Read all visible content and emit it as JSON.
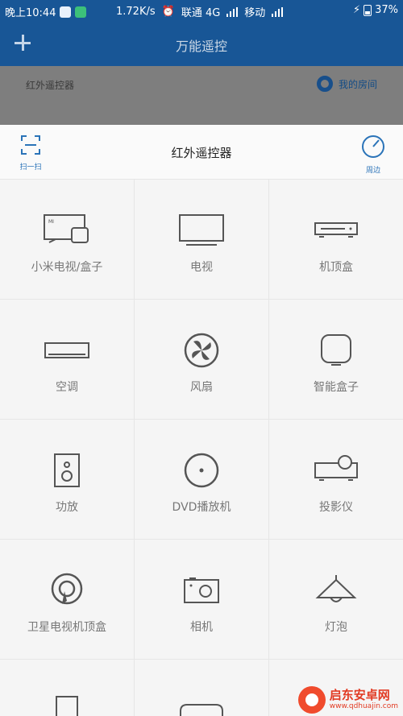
{
  "status_bar": {
    "time": "晚上10:44",
    "speed": "1.72K/s",
    "carrier1": "联通 4G",
    "carrier2": "移动",
    "battery": "37%"
  },
  "app_header": {
    "title": "万能遥控",
    "add_icon": "plus-icon"
  },
  "background": {
    "ir_label": "红外遥控器",
    "room_label": "我的房间"
  },
  "sheet": {
    "title": "红外遥控器",
    "scan_label": "扫一扫",
    "nearby_label": "周边",
    "items": [
      {
        "label": "小米电视/盒子",
        "icon": "mi-tv-box-icon"
      },
      {
        "label": "电视",
        "icon": "tv-icon"
      },
      {
        "label": "机顶盒",
        "icon": "set-top-box-icon"
      },
      {
        "label": "空调",
        "icon": "air-conditioner-icon"
      },
      {
        "label": "风扇",
        "icon": "fan-icon"
      },
      {
        "label": "智能盒子",
        "icon": "smart-box-icon"
      },
      {
        "label": "功放",
        "icon": "amplifier-icon"
      },
      {
        "label": "DVD播放机",
        "icon": "dvd-icon"
      },
      {
        "label": "投影仪",
        "icon": "projector-icon"
      },
      {
        "label": "卫星电视机顶盒",
        "icon": "satellite-icon"
      },
      {
        "label": "相机",
        "icon": "camera-icon"
      },
      {
        "label": "灯泡",
        "icon": "lamp-icon"
      }
    ]
  },
  "watermark": {
    "title": "启东安卓网",
    "url": "www.qdhuajin.com"
  },
  "colors": {
    "header_blue": "#185696",
    "accent_blue": "#2a73b8",
    "icon_gray": "#555555"
  }
}
